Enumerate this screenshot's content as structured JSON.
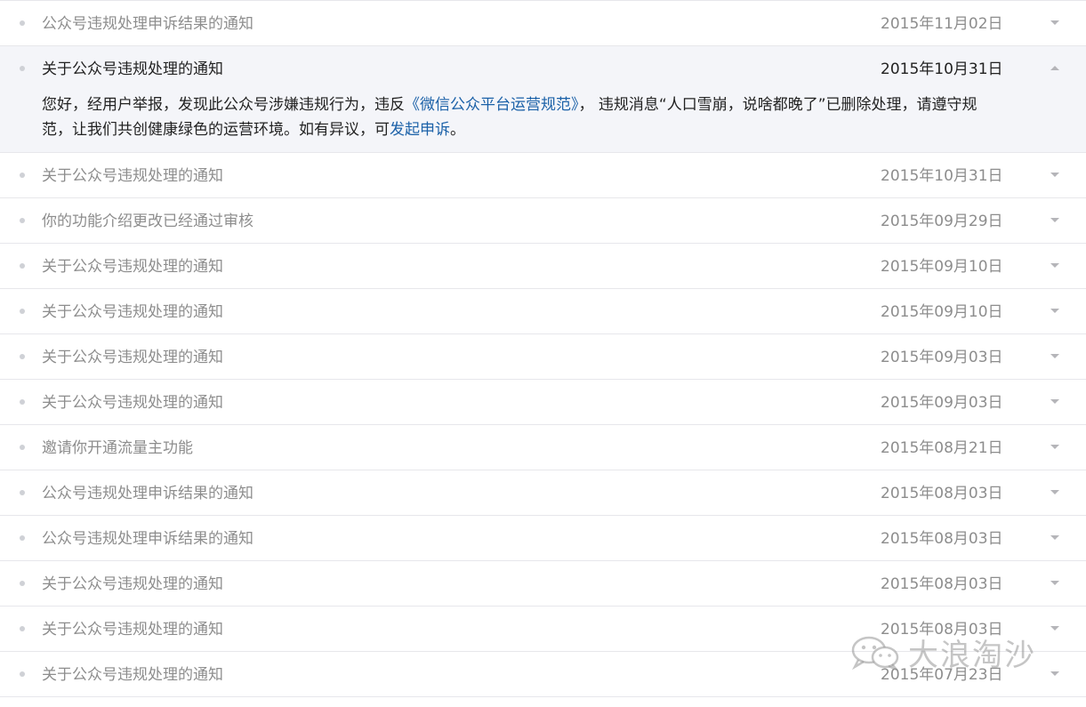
{
  "notifications": [
    {
      "title": "公众号违规处理申诉结果的通知",
      "date": "2015年11月02日"
    },
    {
      "title": "关于公众号违规处理的通知",
      "date": "2015年10月31日",
      "expanded": true,
      "detail": {
        "prefix": "您好，经用户举报，发现此公众号涉嫌违规行为，违反",
        "policy_link": "《微信公众平台运营规范》",
        "middle": "， 违规消息“人口雪崩，说啥都晚了”已删除处理，请遵守规范，让我们共创健康绿色的运营环境。如有异议，可",
        "appeal_link": "发起申诉",
        "suffix": "。"
      }
    },
    {
      "title": "关于公众号违规处理的通知",
      "date": "2015年10月31日"
    },
    {
      "title": "你的功能介绍更改已经通过审核",
      "date": "2015年09月29日"
    },
    {
      "title": "关于公众号违规处理的通知",
      "date": "2015年09月10日"
    },
    {
      "title": "关于公众号违规处理的通知",
      "date": "2015年09月10日"
    },
    {
      "title": "关于公众号违规处理的通知",
      "date": "2015年09月03日"
    },
    {
      "title": "关于公众号违规处理的通知",
      "date": "2015年09月03日"
    },
    {
      "title": "邀请你开通流量主功能",
      "date": "2015年08月21日"
    },
    {
      "title": "公众号违规处理申诉结果的通知",
      "date": "2015年08月03日"
    },
    {
      "title": "公众号违规处理申诉结果的通知",
      "date": "2015年08月03日"
    },
    {
      "title": "关于公众号违规处理的通知",
      "date": "2015年08月03日"
    },
    {
      "title": "关于公众号违规处理的通知",
      "date": "2015年08月03日"
    },
    {
      "title": "关于公众号违规处理的通知",
      "date": "2015年07月23日"
    }
  ],
  "watermark": {
    "text": "大浪淘沙",
    "icon": "wechat-icon"
  },
  "colors": {
    "link": "#1b61a8",
    "expanded_bg": "#f4f5f9",
    "muted_text": "#8d8d8d",
    "divider": "#e7e7eb"
  }
}
